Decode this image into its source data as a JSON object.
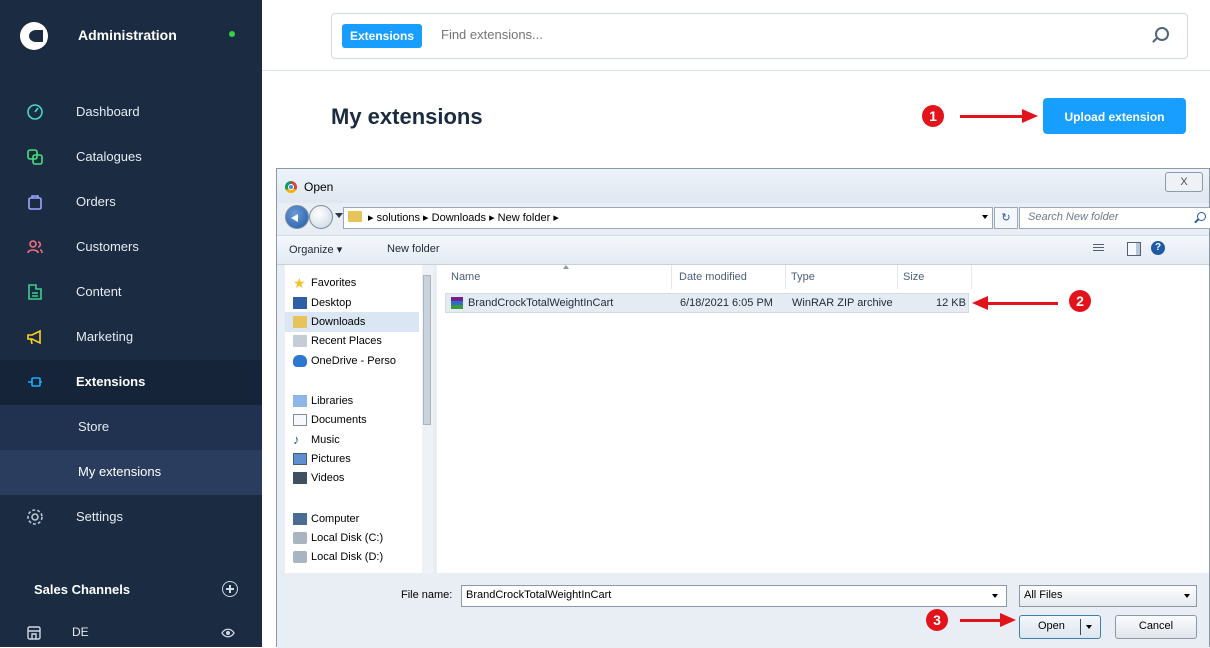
{
  "sidebar": {
    "title": "Administration",
    "nav": [
      {
        "label": "Dashboard",
        "icon": "dashboard-icon"
      },
      {
        "label": "Catalogues",
        "icon": "catalogues-icon"
      },
      {
        "label": "Orders",
        "icon": "orders-icon"
      },
      {
        "label": "Customers",
        "icon": "customers-icon"
      },
      {
        "label": "Content",
        "icon": "content-icon"
      },
      {
        "label": "Marketing",
        "icon": "marketing-icon"
      },
      {
        "label": "Extensions",
        "icon": "extensions-icon"
      }
    ],
    "sub_items": [
      {
        "label": "Store"
      },
      {
        "label": "My extensions"
      }
    ],
    "settings_label": "Settings",
    "sales_channels_label": "Sales Channels",
    "sales_channel_item": "DE",
    "colors": {
      "background": "#1b2b42",
      "accent": "#189eff",
      "status_dot": "#37d046"
    }
  },
  "search": {
    "tag": "Extensions",
    "placeholder": "Find extensions..."
  },
  "page": {
    "title": "My extensions",
    "upload_button": "Upload extension"
  },
  "annotations": {
    "step1": "1",
    "step2": "2",
    "step3": "3",
    "color": "#e2131b"
  },
  "dialog": {
    "title": "Open",
    "close_glyph": "X",
    "address": "▸ solutions ▸ Downloads ▸ New folder ▸",
    "search_placeholder": "Search New folder",
    "toolbar": {
      "organize": "Organize ▾",
      "new_folder": "New folder",
      "help": "?"
    },
    "nav_pane": [
      {
        "label": "Favorites",
        "icon": "star-icon"
      },
      {
        "label": "Desktop",
        "icon": "desktop-icon"
      },
      {
        "label": "Downloads",
        "icon": "folder-icon"
      },
      {
        "label": "Recent Places",
        "icon": "recent-places-icon"
      },
      {
        "label": "OneDrive - Perso",
        "icon": "cloud-icon"
      },
      {
        "label": "Libraries",
        "icon": "library-icon"
      },
      {
        "label": "Documents",
        "icon": "document-icon"
      },
      {
        "label": "Music",
        "icon": "music-icon"
      },
      {
        "label": "Pictures",
        "icon": "pictures-icon"
      },
      {
        "label": "Videos",
        "icon": "videos-icon"
      },
      {
        "label": "Computer",
        "icon": "computer-icon"
      },
      {
        "label": "Local Disk (C:)",
        "icon": "disk-icon"
      },
      {
        "label": "Local Disk (D:)",
        "icon": "disk-icon"
      }
    ],
    "columns": {
      "name": "Name",
      "date": "Date modified",
      "type": "Type",
      "size": "Size"
    },
    "files": [
      {
        "name": "BrandCrockTotalWeightInCart",
        "date": "6/18/2021 6:05 PM",
        "type": "WinRAR ZIP archive",
        "size": "12 KB"
      }
    ],
    "file_name_label": "File name:",
    "file_name_value": "BrandCrockTotalWeightInCart",
    "filter": "All Files",
    "open_button": "Open",
    "cancel_button": "Cancel"
  }
}
